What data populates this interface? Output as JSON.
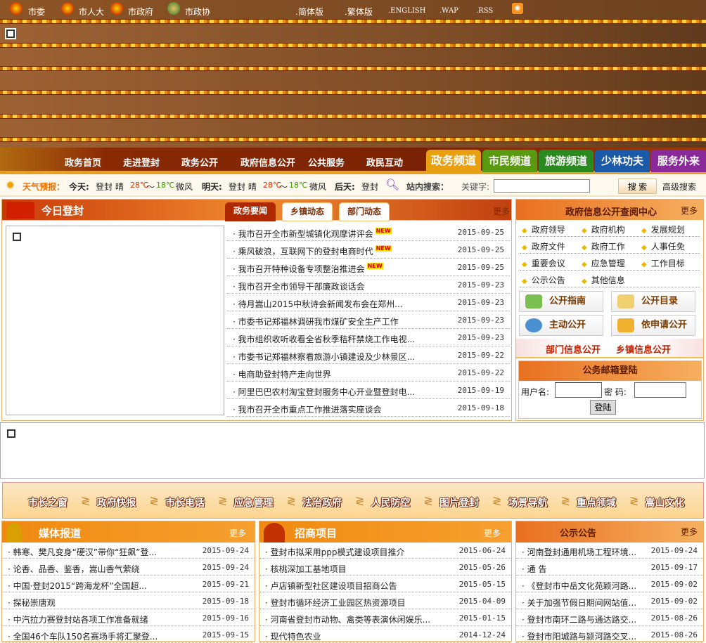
{
  "topbar": {
    "links": [
      "市委",
      "市人大",
      "市政府",
      "市政协"
    ],
    "versions": [
      ".简体版",
      ".繁体版",
      ".ENGLISH",
      ".WAP",
      ".RSS"
    ]
  },
  "nav": {
    "menu": [
      "政务首页",
      "走进登封",
      "政务公开",
      "政府信息公开",
      "公共服务",
      "政民互动"
    ],
    "channels": [
      {
        "label": "政务频道",
        "color": "#e8a010"
      },
      {
        "label": "市民频道",
        "color": "#5a9a10"
      },
      {
        "label": "旅游频道",
        "color": "#2a8a20"
      },
      {
        "label": "少林功夫",
        "color": "#1a5aa8"
      },
      {
        "label": "服务外来",
        "color": "#8a2a9a"
      }
    ]
  },
  "weather": {
    "label": "天气预报：",
    "today_label": "今天:",
    "today": "登封 晴",
    "today_high": "28℃",
    "sep": "～",
    "today_low": "18℃",
    "today_wind": "微风",
    "tomorrow_label": "明天:",
    "tomorrow": "登封 晴",
    "tomorrow_high": "28℃",
    "tomorrow_low": "18℃",
    "tomorrow_wind": "微风",
    "after_label": "后天:",
    "after": "登封"
  },
  "search": {
    "label": "站内搜索：",
    "keyword_label": "关键字:",
    "value": "",
    "button": "搜 索",
    "advanced": "高级搜索"
  },
  "today": {
    "title": "今日登封",
    "tabs": [
      "政务要闻",
      "乡镇动态",
      "部门动态"
    ],
    "more": "更多",
    "items": [
      {
        "t": "我市召开全市新型城镇化观摩讲评会",
        "d": "2015-09-25",
        "new": "NEW"
      },
      {
        "t": "乘风破浪，互联网下的登封电商时代",
        "d": "2015-09-25",
        "new": "NEW"
      },
      {
        "t": "我市召开特种设备专项整治推进会",
        "d": "2015-09-25",
        "new": "NEW"
      },
      {
        "t": "我市召开全市领导干部廉政谈话会",
        "d": "2015-09-23"
      },
      {
        "t": "待月嵩山2015中秋诗会新闻发布会在郑州...",
        "d": "2015-09-23"
      },
      {
        "t": "市委书记郑福林调研我市煤矿安全生产工作",
        "d": "2015-09-23"
      },
      {
        "t": "我市组织收听收看全省秋季秸秆禁烧工作电视...",
        "d": "2015-09-23"
      },
      {
        "t": "市委书记郑福林察看旅游小镇建设及少林景区...",
        "d": "2015-09-22"
      },
      {
        "t": "电商助登封特产走向世界",
        "d": "2015-09-22"
      },
      {
        "t": "阿里巴巴农村淘宝登封服务中心开业暨登封电...",
        "d": "2015-09-19"
      },
      {
        "t": "我市召开全市重点工作推进落实座谈会",
        "d": "2015-09-18"
      }
    ]
  },
  "govinfo": {
    "title": "政府信息公开查阅中心",
    "more": "更多",
    "items": [
      "政府领导",
      "政府机构",
      "发展规划",
      "政府文件",
      "政府工作",
      "人事任免",
      "重要会议",
      "应急管理",
      "工作目标",
      "公示公告",
      "其他信息"
    ],
    "buttons": [
      "公开指南",
      "公开目录",
      "主动公开",
      "依申请公开"
    ],
    "sublinks": [
      "部门信息公开",
      "乡镇信息公开"
    ]
  },
  "mail": {
    "title": "公务邮箱登陆",
    "user_label": "用户名:",
    "pass_label": "密 码:",
    "user": "",
    "pass": "",
    "login": "登陆"
  },
  "links": [
    "市长之窗",
    "政府快报",
    "市长电话",
    "应急管理",
    "法治政府",
    "人民防空",
    "图片登封",
    "场景导航",
    "重点领域",
    "嵩山文化"
  ],
  "media": {
    "title": "媒体报道",
    "more": "更多",
    "items": [
      {
        "t": "韩寒、樊凡变身“硬汉”带你“狂飙”登...",
        "d": "2015-09-24"
      },
      {
        "t": "论香、品香、鉴香，嵩山香气萦绕",
        "d": "2015-09-24"
      },
      {
        "t": "中国·登封2015“跨海龙杯”全国超...",
        "d": "2015-09-21"
      },
      {
        "t": "探秘崇唐观",
        "d": "2015-09-18"
      },
      {
        "t": "中汽拉力赛登封站各项工作准备就绪",
        "d": "2015-09-16"
      },
      {
        "t": "全国46个车队150名赛场手将汇聚登...",
        "d": "2015-09-15"
      }
    ]
  },
  "invest": {
    "title": "招商项目",
    "more": "更多",
    "items": [
      {
        "t": "登封市拟采用ppp模式建设项目推介",
        "d": "2015-06-24"
      },
      {
        "t": "核桃深加工基地项目",
        "d": "2015-05-26"
      },
      {
        "t": "卢店镇新型社区建设项目招商公告",
        "d": "2015-05-15"
      },
      {
        "t": "登封市循环经济工业园区热资源项目",
        "d": "2015-04-09"
      },
      {
        "t": "河南省登封市动物、禽类等表演休闲娱乐...",
        "d": "2015-01-15"
      },
      {
        "t": "现代特色农业",
        "d": "2014-12-24"
      }
    ]
  },
  "notice": {
    "title": "公示公告",
    "more": "更多",
    "items": [
      {
        "t": "河南登封通用机场工程环境...",
        "d": "2015-09-24"
      },
      {
        "t": "通 告",
        "d": "2015-09-17"
      },
      {
        "t": "《登封市中岳文化苑颖河路...",
        "d": "2015-09-02"
      },
      {
        "t": "关于加强节假日期间网站值...",
        "d": "2015-09-02"
      },
      {
        "t": "登封市南环二路与通达路交...",
        "d": "2015-08-26"
      },
      {
        "t": "登封市阳城路与颍河路交叉...",
        "d": "2015-08-26"
      }
    ]
  }
}
